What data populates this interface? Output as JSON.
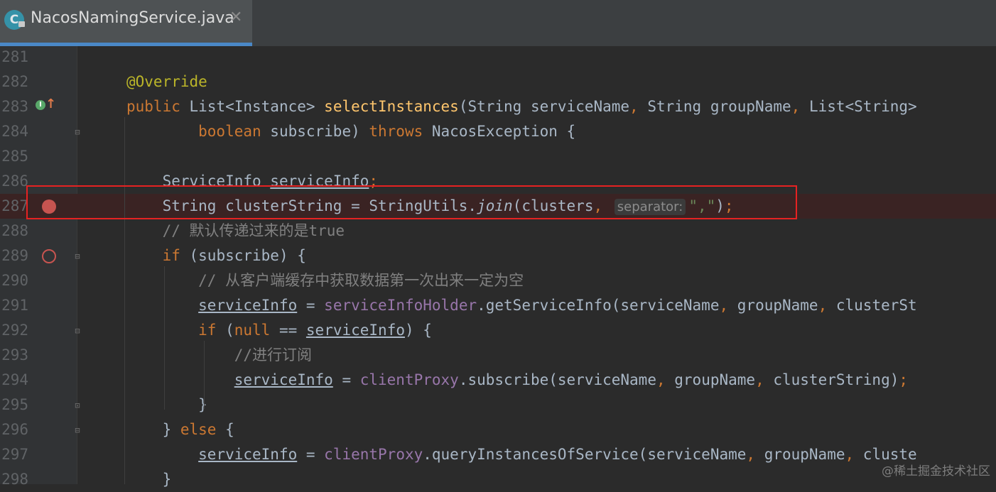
{
  "tab": {
    "title": "NacosNamingService.java",
    "icon_letter": "C",
    "close_glyph": "✕"
  },
  "fold_glyphs": {
    "open": "⊟",
    "close": "⊡"
  },
  "impl_marker": {
    "letter": "I",
    "arrow": "↑"
  },
  "watermark": "@稀土掘金技术社区",
  "colors": {
    "keyword": "#cc7832",
    "annotation": "#bbb529",
    "method": "#ffc66d",
    "comment": "#808080",
    "field": "#9876aa",
    "string": "#6a8759",
    "breakpoint": "#c75450",
    "highlight_box": "#e62222",
    "tab_underline": "#4a88c7"
  },
  "lines": [
    {
      "num": "281",
      "tokens": []
    },
    {
      "num": "282",
      "tokens": [
        {
          "t": "@Override",
          "c": "an"
        }
      ]
    },
    {
      "num": "283",
      "tokens": [
        {
          "t": "public ",
          "c": "kw"
        },
        {
          "t": "List<Instance> "
        },
        {
          "t": "selectInstances",
          "c": "fn"
        },
        {
          "t": "(String serviceName"
        },
        {
          "t": ", ",
          "c": "kw"
        },
        {
          "t": "String groupName"
        },
        {
          "t": ", ",
          "c": "kw"
        },
        {
          "t": "List<String>"
        }
      ]
    },
    {
      "num": "284",
      "tokens": [
        {
          "t": "        boolean ",
          "c": "kw"
        },
        {
          "t": "subscribe) "
        },
        {
          "t": "throws ",
          "c": "kw"
        },
        {
          "t": "NacosException {"
        }
      ]
    },
    {
      "num": "285",
      "tokens": []
    },
    {
      "num": "286",
      "tokens": [
        {
          "t": "    ServiceInfo "
        },
        {
          "t": "serviceInfo",
          "c": "ul"
        },
        {
          "t": ";",
          "c": "kw"
        }
      ]
    },
    {
      "num": "287",
      "tokens": [
        {
          "t": "    String clusterString = StringUtils."
        },
        {
          "t": "join",
          "c": "it"
        },
        {
          "t": "(clusters"
        },
        {
          "t": ", ",
          "c": "kw"
        },
        {
          "t": "separator:",
          "c": "hint"
        },
        {
          "t": "\",\"",
          "c": "str"
        },
        {
          "t": ")"
        },
        {
          "t": ";",
          "c": "kw"
        }
      ]
    },
    {
      "num": "288",
      "tokens": [
        {
          "t": "    // 默认传递过来的是true",
          "c": "cm"
        }
      ]
    },
    {
      "num": "289",
      "tokens": [
        {
          "t": "    "
        },
        {
          "t": "if ",
          "c": "kw"
        },
        {
          "t": "(subscribe) {"
        }
      ]
    },
    {
      "num": "290",
      "tokens": [
        {
          "t": "        // 从客户端缓存中获取数据第一次出来一定为空",
          "c": "cm"
        }
      ]
    },
    {
      "num": "291",
      "tokens": [
        {
          "t": "        "
        },
        {
          "t": "serviceInfo",
          "c": "ul"
        },
        {
          "t": " = "
        },
        {
          "t": "serviceInfoHolder",
          "c": "fld"
        },
        {
          "t": ".getServiceInfo(serviceName"
        },
        {
          "t": ", ",
          "c": "kw"
        },
        {
          "t": "groupName"
        },
        {
          "t": ", ",
          "c": "kw"
        },
        {
          "t": "clusterSt"
        }
      ]
    },
    {
      "num": "292",
      "tokens": [
        {
          "t": "        "
        },
        {
          "t": "if ",
          "c": "kw"
        },
        {
          "t": "("
        },
        {
          "t": "null ",
          "c": "kw"
        },
        {
          "t": "== "
        },
        {
          "t": "serviceInfo",
          "c": "ul"
        },
        {
          "t": ") {"
        }
      ]
    },
    {
      "num": "293",
      "tokens": [
        {
          "t": "            //进行订阅",
          "c": "cm"
        }
      ]
    },
    {
      "num": "294",
      "tokens": [
        {
          "t": "            "
        },
        {
          "t": "serviceInfo",
          "c": "ul"
        },
        {
          "t": " = "
        },
        {
          "t": "clientProxy",
          "c": "fld"
        },
        {
          "t": ".subscribe(serviceName"
        },
        {
          "t": ", ",
          "c": "kw"
        },
        {
          "t": "groupName"
        },
        {
          "t": ", ",
          "c": "kw"
        },
        {
          "t": "clusterString)"
        },
        {
          "t": ";",
          "c": "kw"
        }
      ]
    },
    {
      "num": "295",
      "tokens": [
        {
          "t": "        }"
        }
      ]
    },
    {
      "num": "296",
      "tokens": [
        {
          "t": "    } "
        },
        {
          "t": "else ",
          "c": "kw"
        },
        {
          "t": "{"
        }
      ]
    },
    {
      "num": "297",
      "tokens": [
        {
          "t": "        "
        },
        {
          "t": "serviceInfo",
          "c": "ul"
        },
        {
          "t": " = "
        },
        {
          "t": "clientProxy",
          "c": "fld"
        },
        {
          "t": ".queryInstancesOfService(serviceName"
        },
        {
          "t": ", ",
          "c": "kw"
        },
        {
          "t": "groupName"
        },
        {
          "t": ", ",
          "c": "kw"
        },
        {
          "t": "cluste"
        }
      ]
    },
    {
      "num": "298",
      "tokens": [
        {
          "t": "    }"
        }
      ]
    }
  ],
  "breakpoints": [
    {
      "line": "287",
      "style": "filled"
    },
    {
      "line": "289",
      "style": "hollow"
    }
  ],
  "folds": [
    {
      "line": "284",
      "kind": "open"
    },
    {
      "line": "289",
      "kind": "open"
    },
    {
      "line": "292",
      "kind": "open"
    },
    {
      "line": "295",
      "kind": "close"
    },
    {
      "line": "296",
      "kind": "open"
    }
  ]
}
